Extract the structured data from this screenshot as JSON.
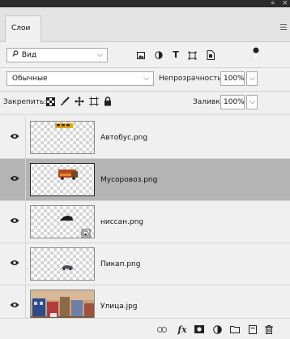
{
  "window": {
    "collapse_glyph": "«",
    "close_glyph": "×"
  },
  "tabs": [
    {
      "label": "Слои"
    }
  ],
  "filter": {
    "kind_label": "Вид",
    "icons": [
      "image-filter-icon",
      "adjustment-filter-icon",
      "type-filter-icon",
      "shape-filter-icon",
      "smart-object-filter-icon"
    ],
    "type_glyph": "T"
  },
  "blend": {
    "mode": "Обычные",
    "opacity_label": "Непрозрачность:",
    "opacity_value": "100%"
  },
  "lock": {
    "label": "Закрепить:",
    "fill_label": "Заливка:",
    "fill_value": "100%"
  },
  "layers": [
    {
      "name": "Автобус.png",
      "selected": false,
      "visible": true,
      "smart": false
    },
    {
      "name": "Мусоровоз.png",
      "selected": true,
      "visible": true,
      "smart": false
    },
    {
      "name": "ниссан.png",
      "selected": false,
      "visible": true,
      "smart": true
    },
    {
      "name": "Пикап.png",
      "selected": false,
      "visible": true,
      "smart": false
    },
    {
      "name": "Улица.jpg",
      "selected": false,
      "visible": true,
      "smart": false
    }
  ],
  "bottom_toolbar": {
    "fx_label": "fx",
    "icons": [
      "link-icon",
      "fx-icon",
      "mask-icon",
      "adjustment-icon",
      "folder-icon",
      "new-layer-icon",
      "trash-icon"
    ]
  },
  "colors": {
    "panel_bg": "#f0f0f0",
    "selected_row": "#b4b4b4",
    "title_bar": "#2b2b2b"
  }
}
